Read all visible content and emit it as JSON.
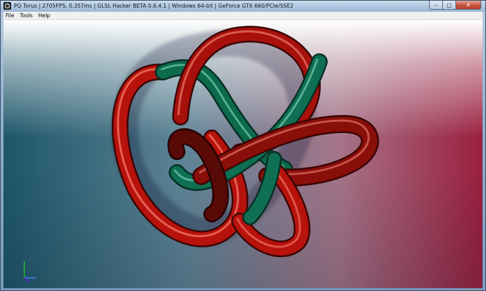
{
  "window": {
    "title": "PQ Torus | 2705FPS, 0.357ms | GLSL Hacker BETA 0.6.4.1 | Windows 64-bit | GeForce GTX 660/PCIe/SSE2"
  },
  "window_controls": {
    "minimize": "‒",
    "maximize": "□",
    "close": "✕"
  },
  "menu": {
    "items": [
      {
        "label": "File"
      },
      {
        "label": "Tools"
      },
      {
        "label": "Help"
      }
    ]
  },
  "scene": {
    "object": "pq-torus-knot",
    "tube_colors": {
      "outer": "#c0140d",
      "inner": "#0a6a4c",
      "highlight": "#ffffff"
    },
    "background_colors": {
      "top": "#ffffff",
      "left": "#1d5569",
      "right": "#9b1f3f"
    },
    "axis_colors": {
      "x": "#3d8bff",
      "y": "#1fbe2c",
      "z": "#5a1ad8"
    }
  },
  "icons": {
    "app": "glsl-hacker-app-icon",
    "axis": "xyz-axis-gizmo"
  }
}
